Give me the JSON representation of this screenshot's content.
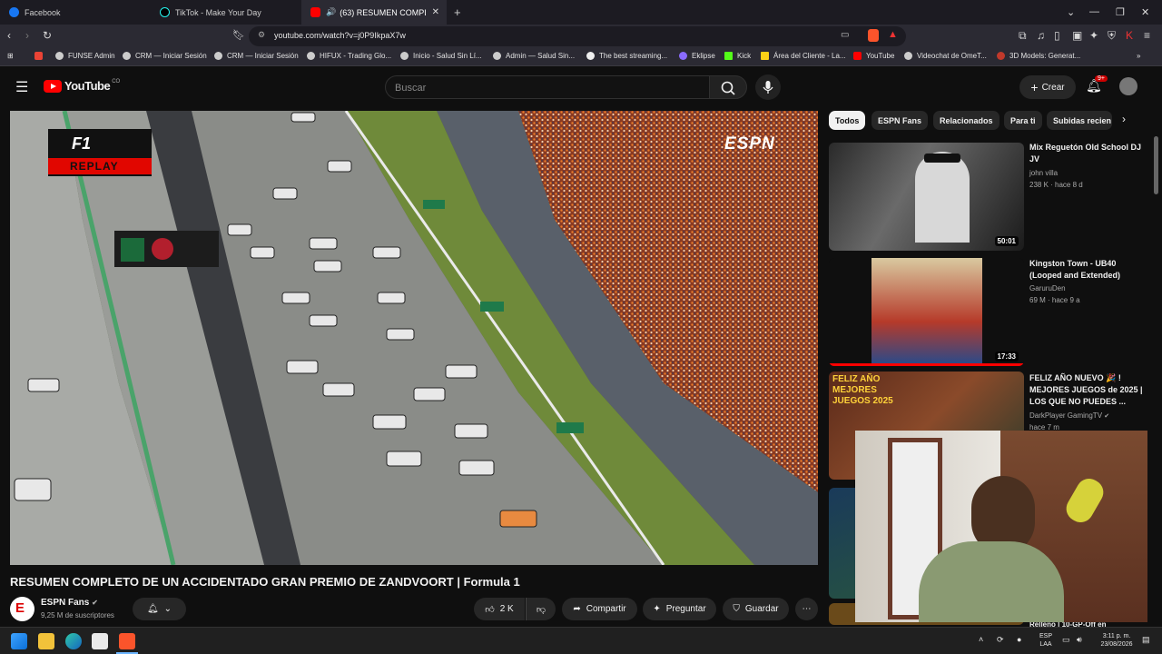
{
  "browser": {
    "tabs": [
      {
        "label": "Facebook",
        "icon": "facebook-icon"
      },
      {
        "label": "TikTok - Make Your Day",
        "icon": "tiktok-icon"
      },
      {
        "label": "(63) RESUMEN COMPLETO DE",
        "icon": "youtube-icon"
      }
    ],
    "url": "youtube.com/watch?v=j0P9IkpaX7w",
    "bookmarks": [
      "FUNSE Admin",
      "CRM — Iniciar Sesión",
      "CRM — Iniciar Sesión",
      "HIFUX - Trading Glo...",
      "Inicio - Salud Sin Lí...",
      "Admin — Salud Sin...",
      "The best streaming...",
      "Eklipse",
      "Kick",
      "Área del Cliente - La...",
      "YouTube",
      "Videochat de OmeT...",
      "3D Models: Generat..."
    ]
  },
  "youtube": {
    "logo": "YouTube",
    "country_code": "CO",
    "search_placeholder": "Buscar",
    "create_label": "Crear",
    "notifications": "9+"
  },
  "video": {
    "overlay_brand": "ESPN",
    "overlay_f1": "F1",
    "overlay_replay": "REPLAY",
    "title": "RESUMEN COMPLETO DE UN ACCIDENTADO GRAN PREMIO DE ZANDVOORT | Formula 1",
    "channel": "ESPN Fans",
    "subscribers": "9,25 M de suscriptores",
    "likes": "2 K",
    "share": "Compartir",
    "ask": "Preguntar",
    "save": "Guardar"
  },
  "filters": [
    "Todos",
    "ESPN Fans",
    "Relacionados",
    "Para ti",
    "Subidas recien"
  ],
  "recommendations": [
    {
      "title": "Mix Reguetón Old School DJ JV",
      "channel": "john villa",
      "stats": "238 K · hace 8 d",
      "duration": "50:01"
    },
    {
      "title": "Kingston Town - UB40 (Looped and Extended)",
      "channel": "GaruruDen",
      "stats": "69 M · hace 9 a",
      "duration": "17:33"
    },
    {
      "title": "FELIZ AÑO NUEVO 🎉 ! MEJORES JUEGOS de 2025 | LOS QUE NO PUEDES ...",
      "channel": "DarkPlayer GamingTV",
      "stats": "hace 7 m",
      "thumb_text": "FELIZ AÑO MEJORES JUEGOS 2025"
    }
  ],
  "partial_rec_title": "Relleno | 10-GP-Off en",
  "taskbar": {
    "lang": "ESP",
    "lang2": "LAA",
    "time": "3:11 p. m.",
    "date": "23/08/2026"
  },
  "colors": {
    "youtube_red": "#ff0000",
    "background": "#0f0f0f"
  }
}
